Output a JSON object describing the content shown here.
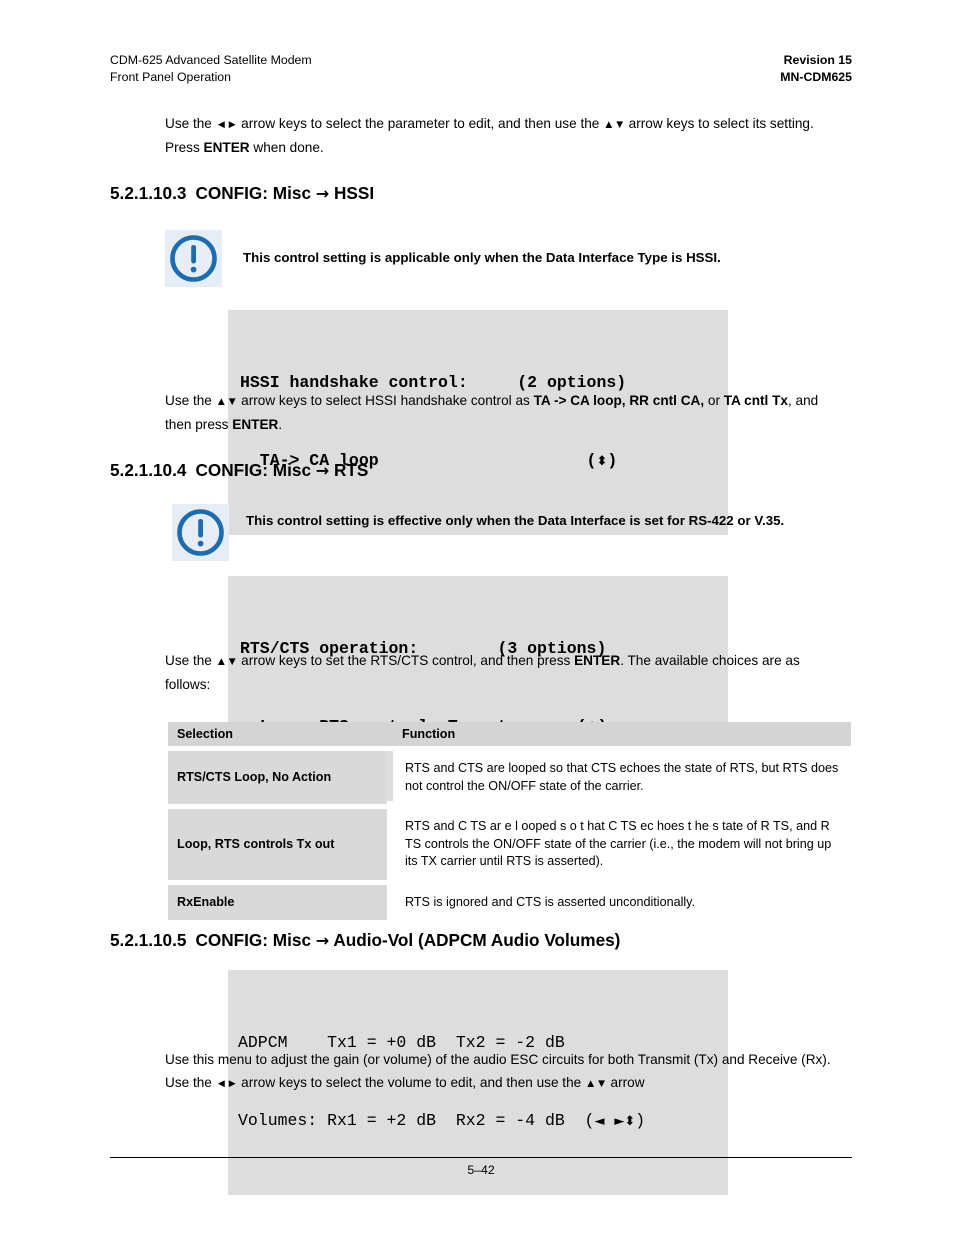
{
  "header": {
    "left_line1": "CDM-625 Advanced Satellite Modem",
    "left_line2": "Front Panel Operation",
    "right_line1": "Revision 15",
    "right_line2": "MN-CDM625"
  },
  "intro_paragraph": {
    "part1": "Use the ",
    "arrows_lr": "◄►",
    "part2": " arrow keys to select the parameter to edit, and then use the ",
    "arrows_ud": "▲▼",
    "part3": " arrow keys to select its setting. Press ",
    "bold_enter": "ENTER",
    "part4": " when done."
  },
  "section_hssi": {
    "number": "5.2.1.10.3",
    "title_prefix": "CONFIG: Misc ",
    "arrow": "→",
    "title_suffix": " HSSI",
    "note": "This control setting is applicable only when the Data Interface Type is HSSI.",
    "note_icon": "exclamation-circle-icon",
    "lcd": {
      "line1": "HSSI handshake control:     (2 options)",
      "line2_text": "  TA-> CA loop                     (",
      "line2_arrow": "⬍",
      "line2_tail": ")"
    },
    "body": {
      "part1": "Use the ",
      "arrows_ud": "▲▼",
      "part2": " arrow keys to select HSSI handshake control as ",
      "bold1": "TA -> CA loop, RR cntl CA,",
      "part3": " or ",
      "bold2": "TA cntl Tx",
      "part4": ", and then press ",
      "bold3": "ENTER",
      "part5": "."
    }
  },
  "section_rts": {
    "number": "5.2.1.10.4",
    "title_prefix": "CONFIG: Misc ",
    "arrow": "→",
    "title_suffix": " RTS",
    "note": "This control setting is effective only when the Data Interface is set for RS-422 or V.35.",
    "note_icon": "exclamation-circle-icon",
    "lcd": {
      "line1": "RTS/CTS operation:        (3 options)",
      "line2_text": "  Loop, RTS controls Tx-out       (",
      "line2_arrow": "⬍",
      "line2_tail": ")"
    },
    "body": {
      "part1": "Use the ",
      "arrows_ud": "▲▼",
      "part2": " arrow keys to set the RTS/CTS control, and then press ",
      "bold1": "ENTER",
      "part3": ". The available choices are as follows:"
    },
    "table": {
      "columns": [
        "Selection",
        "Function"
      ],
      "rows": [
        {
          "selection": "RTS/CTS Loop, No Action",
          "function": "RTS and CTS are looped so that CTS echoes the state of RTS, but RTS does not control the ON/OFF state of the carrier."
        },
        {
          "selection": "Loop, RTS controls Tx out",
          "function": "RTS and C TS ar e l ooped s o t hat C TS ec hoes t he s tate of  R TS, and R  TS controls the ON/OFF state of the carrier (i.e., the modem will not bring up its TX carrier until RTS is asserted)."
        },
        {
          "selection": "RxEnable",
          "function": "RTS is ignored and CTS is asserted unconditionally."
        }
      ]
    }
  },
  "section_audio": {
    "number": "5.2.1.10.5",
    "title_prefix": "CONFIG: Misc ",
    "arrow": "→",
    "title_suffix": " Audio-Vol (ADPCM Audio Volumes)",
    "lcd": {
      "line1": "ADPCM    Tx1 = +0 dB  Tx2 = -2 dB",
      "line2_text": "Volumes: Rx1 = +2 dB  Rx2 = -4 dB  (",
      "line2_arrow_left": "◄",
      "line2_arrow_right": "►",
      "line2_arrow_ud": "⬍",
      "line2_tail": ")"
    },
    "body": {
      "part1": "Use this menu to adjust the gain (or volume) of the audio ESC circuits for both Transmit (Tx) and Receive (Rx). Use the ",
      "arrows_lr": "◄►",
      "part2": " arrow keys to select the volume to edit, and then use the ",
      "arrows_ud": "▲▼",
      "part3": " arrow"
    }
  },
  "footer": {
    "page_number": "5–42"
  },
  "colors": {
    "lcd_background": "#dddddd",
    "note_icon_background": "#e7edf4",
    "note_icon_blue": "#1b6cb0",
    "table_header": "#d4d4d4",
    "table_selection_cell": "#d9d9d9"
  }
}
